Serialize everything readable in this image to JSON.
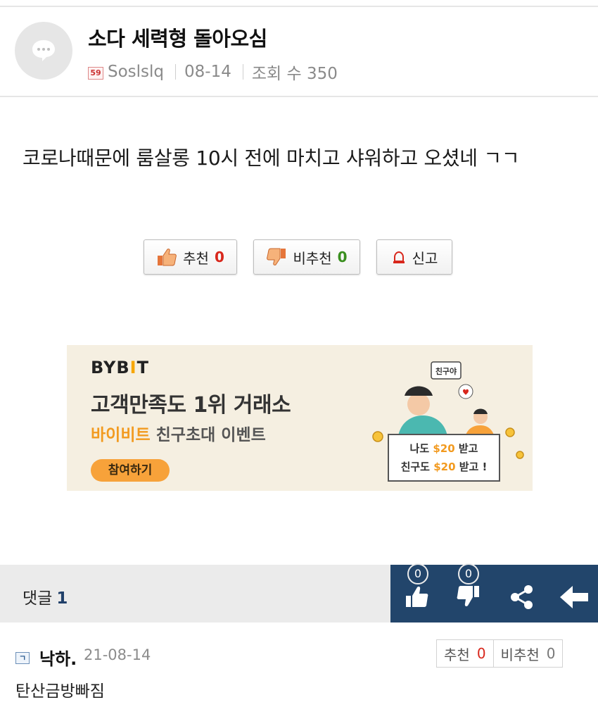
{
  "post": {
    "title": "소다 세력형 돌아오심",
    "level_badge": "59",
    "author": "Soslslq",
    "date": "08-14",
    "views": "조회 수 350",
    "body": "코로나때문에 룸살롱 10시 전에 마치고 샤워하고 오셨네 ㄱㄱ"
  },
  "votes": {
    "up_label": "추천",
    "up_count": "0",
    "down_label": "비추천",
    "down_count": "0",
    "report_label": "신고"
  },
  "ad": {
    "brand_prefix": "BYB",
    "brand_mark": "I",
    "brand_suffix": "T",
    "headline": "고객만족도 1위 거래소",
    "sub_highlight": "바이비트",
    "sub_rest": " 친구초대 이벤트",
    "cta": "참여하기",
    "bubble": "친구야",
    "card_line1_pre": "나도 ",
    "card_line1_amt": "$20",
    "card_line1_post": " 받고",
    "card_line2_pre": "친구도 ",
    "card_line2_amt": "$20",
    "card_line2_post": " 받고 !"
  },
  "comments_bar": {
    "label": "댓글",
    "count": "1",
    "like_count": "0",
    "dislike_count": "0"
  },
  "comment": {
    "author": "낙하.",
    "date": "21-08-14",
    "up_label": "추천",
    "up_count": "0",
    "down_label": "비추천",
    "down_count": "0",
    "text": "탄산금방빠짐"
  },
  "colors": {
    "action_bar": "#22456b",
    "count_red": "#d8271c",
    "count_green": "#3a8f1f",
    "ad_accent": "#f29a1f"
  }
}
